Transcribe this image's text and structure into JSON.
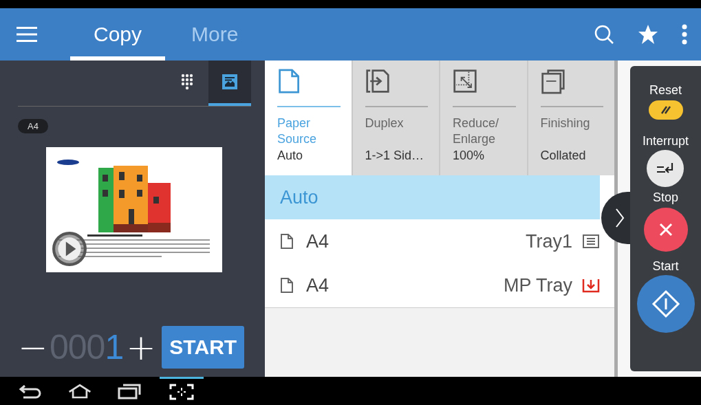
{
  "header": {
    "tabs": [
      {
        "label": "Copy",
        "selected": true
      },
      {
        "label": "More",
        "selected": false
      }
    ]
  },
  "preview": {
    "view_toggles": [
      {
        "kind": "keypad",
        "selected": false
      },
      {
        "kind": "preview",
        "selected": true
      }
    ],
    "paper_badge": "A4"
  },
  "quantity": {
    "value": "0001",
    "minus": "−",
    "plus": "+"
  },
  "start_button": "START",
  "options": [
    {
      "kind": "paper",
      "label": "Paper Source",
      "value": "Auto",
      "selected": true
    },
    {
      "kind": "duplex",
      "label": "Duplex",
      "value": "1->1 Sid…",
      "selected": false
    },
    {
      "kind": "scale",
      "label": "Reduce/ Enlarge",
      "value": "100%",
      "selected": false
    },
    {
      "kind": "finishing",
      "label": "Finishing",
      "value": "Collated",
      "selected": false
    }
  ],
  "paper_list": [
    {
      "kind": "auto",
      "label": "Auto",
      "selected": true
    },
    {
      "kind": "tray",
      "size": "A4",
      "tray": "Tray1",
      "selected": false
    },
    {
      "kind": "mp",
      "size": "A4",
      "tray": "MP Tray",
      "selected": false
    }
  ],
  "actions": [
    {
      "kind": "reset",
      "label": "Reset"
    },
    {
      "kind": "interrupt",
      "label": "Interrupt"
    },
    {
      "kind": "stop",
      "label": "Stop"
    },
    {
      "kind": "start",
      "label": "Start"
    }
  ]
}
